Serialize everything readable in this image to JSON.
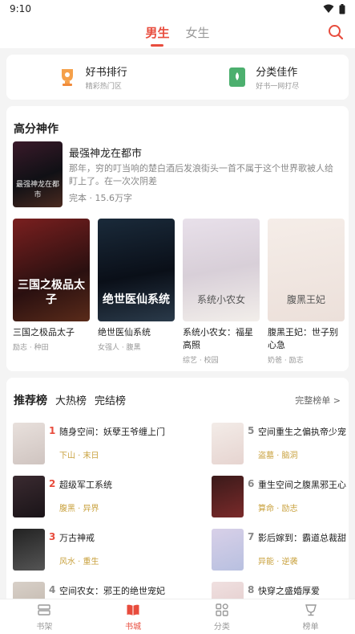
{
  "status": {
    "time": "9:10"
  },
  "header": {
    "tabs": [
      {
        "label": "男生"
      },
      {
        "label": "女生"
      }
    ]
  },
  "quick": [
    {
      "title": "好书排行",
      "subtitle": "精彩热门区",
      "icon": "trophy-icon"
    },
    {
      "title": "分类佳作",
      "subtitle": "好书一网打尽",
      "icon": "bookmark-icon"
    }
  ],
  "gaofen": {
    "title": "高分神作",
    "featured": {
      "title": "最强神龙在都市",
      "desc": "那年，穷的叮当响的楚白酒后发浪街头一首不属于这个世界歌被人给盯上了。在一次次阴差",
      "meta": "完本 · 15.6万字",
      "cover_text": "最强神龙在都市"
    },
    "books": [
      {
        "title": "三国之极品太子",
        "tags": "励志 · 种田",
        "cover_text": "三国之极品太子"
      },
      {
        "title": "绝世医仙系统",
        "tags": "女强人 · 腹黑",
        "cover_text": "绝世医仙系统"
      },
      {
        "title": "系统小农女：福星高照",
        "tags": "综艺 · 校园",
        "cover_text": "系统小农女"
      },
      {
        "title": "腹黑王妃：世子别心急",
        "tags": "奶爸 · 励志",
        "cover_text": "腹黑王妃"
      }
    ]
  },
  "rank": {
    "tabs": [
      {
        "label": "推荐榜"
      },
      {
        "label": "大热榜"
      },
      {
        "label": "完结榜"
      }
    ],
    "more": "完整榜单 >",
    "items": [
      {
        "num": "1",
        "title": "随身空间：妖孽王爷缠上门",
        "tags": "下山 · 末日"
      },
      {
        "num": "2",
        "title": "超级军工系统",
        "tags": "腹黑 · 异界"
      },
      {
        "num": "3",
        "title": "万古神戒",
        "tags": "风水 · 重生"
      },
      {
        "num": "4",
        "title": "空间农女：邪王的绝世宠妃",
        "tags": ""
      },
      {
        "num": "5",
        "title": "空间重生之偏执帝少宠",
        "tags": "盗墓 · 脑洞"
      },
      {
        "num": "6",
        "title": "重生空间之腹黑邪王心",
        "tags": "算命 · 励志"
      },
      {
        "num": "7",
        "title": "影后嫁到：霸道总裁甜",
        "tags": "异能 · 逆袭"
      },
      {
        "num": "8",
        "title": "快穿之盛婚厚爱",
        "tags": ""
      }
    ]
  },
  "nav": [
    {
      "label": "书架"
    },
    {
      "label": "书城"
    },
    {
      "label": "分类"
    },
    {
      "label": "榜单"
    }
  ],
  "colors": {
    "accent": "#e84c3d",
    "tag": "#c9a23f"
  }
}
